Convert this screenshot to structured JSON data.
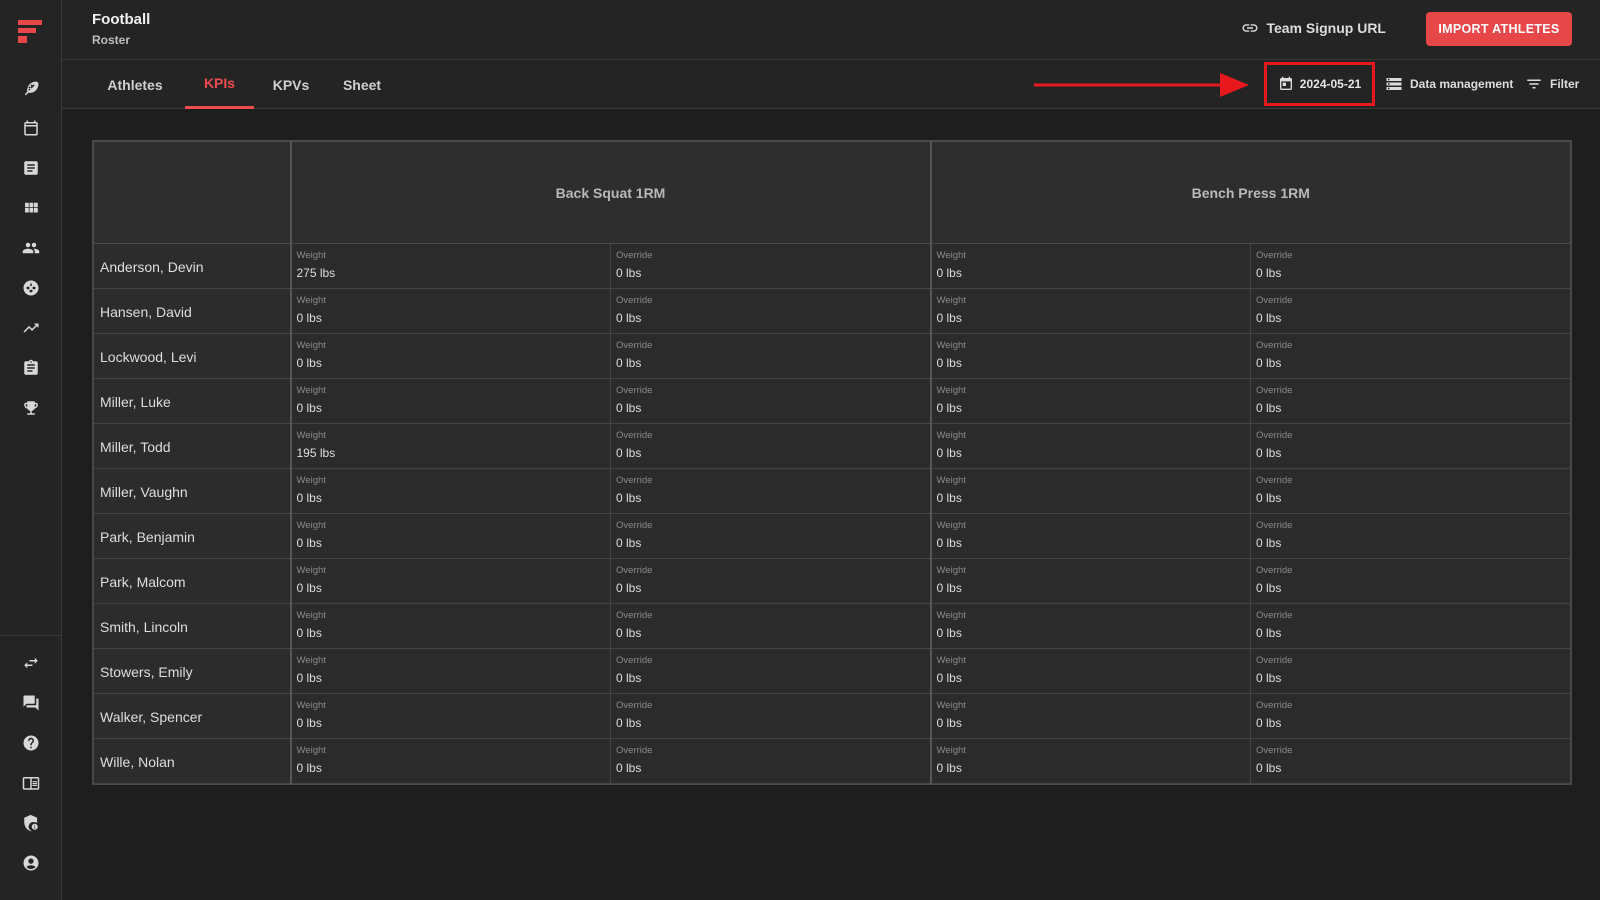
{
  "header": {
    "title": "Football",
    "subtitle": "Roster",
    "signup_label": "Team Signup URL",
    "import_label": "IMPORT ATHLETES"
  },
  "tabs": [
    {
      "label": "Athletes",
      "active": false
    },
    {
      "label": "KPIs",
      "active": true
    },
    {
      "label": "KPVs",
      "active": false
    },
    {
      "label": "Sheet",
      "active": false
    }
  ],
  "toolbar": {
    "date": "2024-05-21",
    "data_management": "Data management",
    "filter": "Filter"
  },
  "sidebar_icons": [
    "football-icon",
    "calendar-icon",
    "notes-icon",
    "apps-grid-icon",
    "people-icon",
    "ball-icon",
    "trending-icon",
    "clipboard-icon",
    "trophy-icon",
    "swap-icon",
    "chat-icon",
    "help-icon",
    "table-icon",
    "security-icon",
    "account-icon"
  ],
  "colors": {
    "accent": "#ee4b4e",
    "import_button": "#e8474a",
    "highlight_box": "#e8191c",
    "background": "#1e1e1e"
  },
  "table": {
    "groups": [
      "Back Squat 1RM",
      "Bench Press 1RM"
    ],
    "sub_labels": [
      "Weight",
      "Override"
    ],
    "rows": [
      {
        "name": "Anderson, Devin",
        "values": [
          "275 lbs",
          "0 lbs",
          "0 lbs",
          "0 lbs"
        ]
      },
      {
        "name": "Hansen, David",
        "values": [
          "0 lbs",
          "0 lbs",
          "0 lbs",
          "0 lbs"
        ]
      },
      {
        "name": "Lockwood, Levi",
        "values": [
          "0 lbs",
          "0 lbs",
          "0 lbs",
          "0 lbs"
        ]
      },
      {
        "name": "Miller, Luke",
        "values": [
          "0 lbs",
          "0 lbs",
          "0 lbs",
          "0 lbs"
        ]
      },
      {
        "name": "Miller, Todd",
        "values": [
          "195 lbs",
          "0 lbs",
          "0 lbs",
          "0 lbs"
        ]
      },
      {
        "name": "Miller, Vaughn",
        "values": [
          "0 lbs",
          "0 lbs",
          "0 lbs",
          "0 lbs"
        ]
      },
      {
        "name": "Park, Benjamin",
        "values": [
          "0 lbs",
          "0 lbs",
          "0 lbs",
          "0 lbs"
        ]
      },
      {
        "name": "Park, Malcom",
        "values": [
          "0 lbs",
          "0 lbs",
          "0 lbs",
          "0 lbs"
        ]
      },
      {
        "name": "Smith, Lincoln",
        "values": [
          "0 lbs",
          "0 lbs",
          "0 lbs",
          "0 lbs"
        ]
      },
      {
        "name": "Stowers, Emily",
        "values": [
          "0 lbs",
          "0 lbs",
          "0 lbs",
          "0 lbs"
        ]
      },
      {
        "name": "Walker, Spencer",
        "values": [
          "0 lbs",
          "0 lbs",
          "0 lbs",
          "0 lbs"
        ]
      },
      {
        "name": "Wille, Nolan",
        "values": [
          "0 lbs",
          "0 lbs",
          "0 lbs",
          "0 lbs"
        ]
      }
    ]
  }
}
